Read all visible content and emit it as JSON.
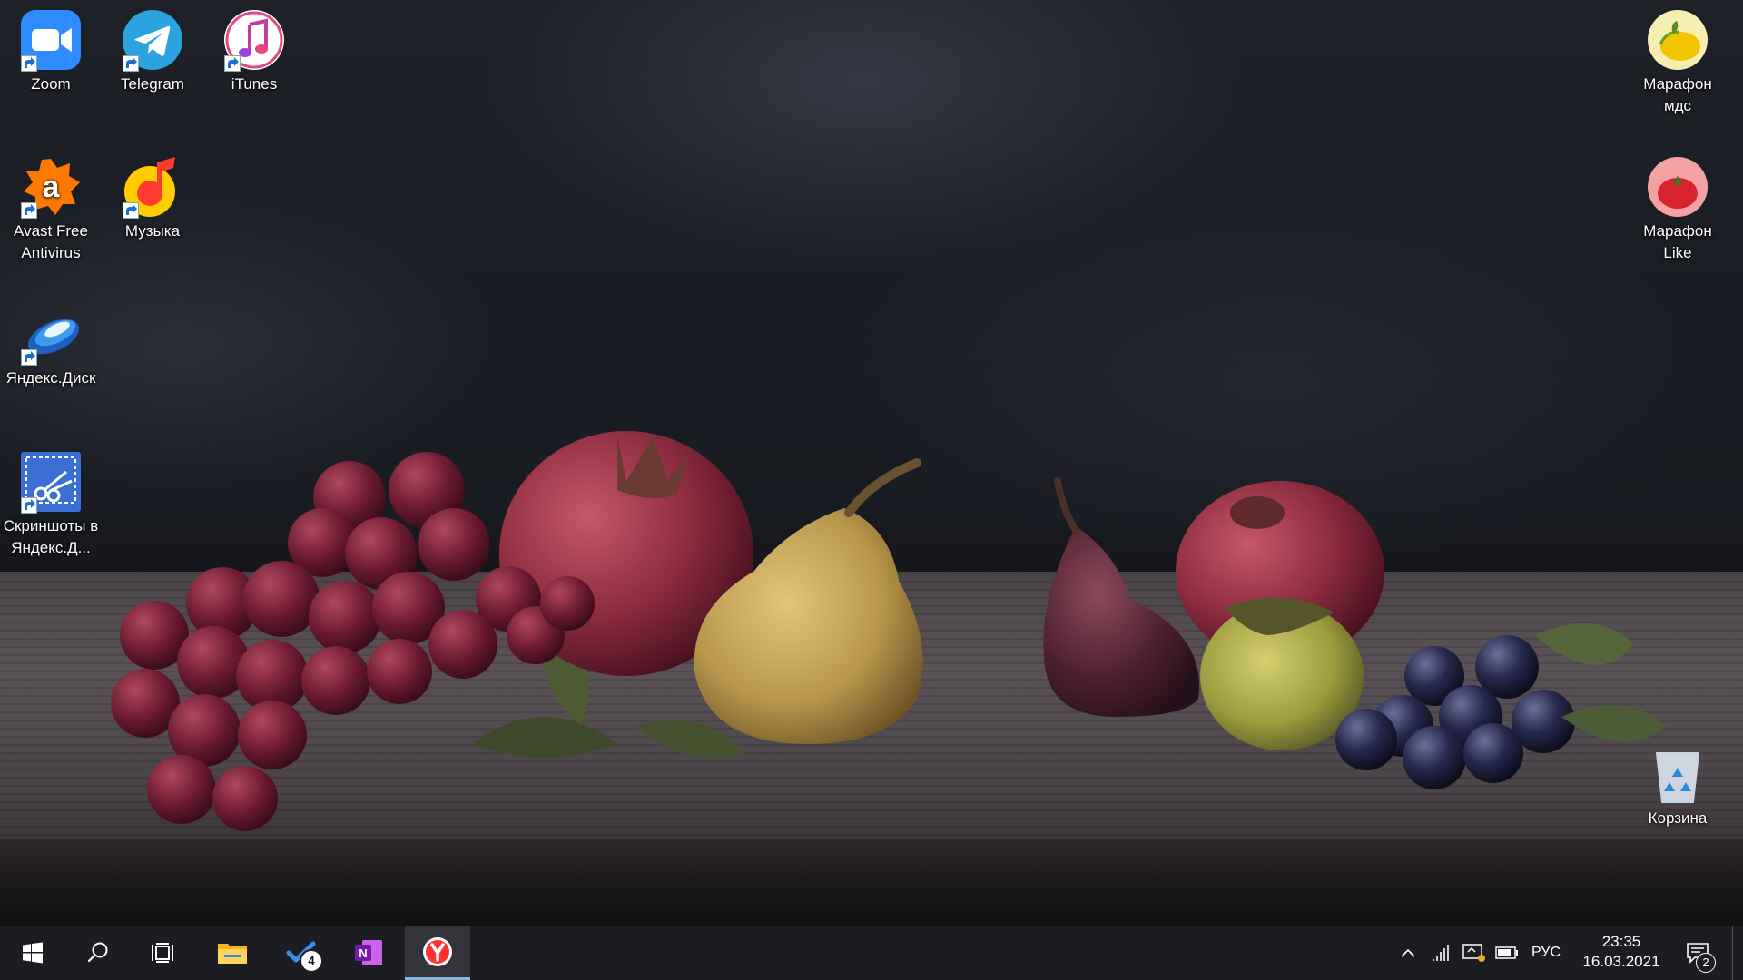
{
  "desktop": {
    "icons_left": [
      {
        "id": "zoom",
        "label": "Zoom"
      },
      {
        "id": "telegram",
        "label": "Telegram"
      },
      {
        "id": "itunes",
        "label": "iTunes"
      },
      {
        "id": "avast",
        "label": "Avast Free Antivirus"
      },
      {
        "id": "music",
        "label": "Музыка"
      },
      {
        "id": "yadisk",
        "label": "Яндекс.Диск"
      },
      {
        "id": "screenshots",
        "label": "Скриншоты в Яндекс.Д..."
      }
    ],
    "icons_right": [
      {
        "id": "marathon-mds",
        "label": "Марафон мдс"
      },
      {
        "id": "marathon-like",
        "label": "Марафон Like"
      },
      {
        "id": "recycle-bin",
        "label": "Корзина"
      }
    ]
  },
  "taskbar": {
    "pinned": [
      {
        "id": "start",
        "icon": "windows-logo-icon"
      },
      {
        "id": "search",
        "icon": "search-icon"
      },
      {
        "id": "task-view",
        "icon": "task-view-icon"
      },
      {
        "id": "file-explorer",
        "icon": "folder-icon"
      },
      {
        "id": "todo",
        "icon": "checkmark-icon",
        "badge": "4"
      },
      {
        "id": "onenote",
        "icon": "onenote-icon"
      },
      {
        "id": "yandex-browser",
        "icon": "yandex-browser-icon",
        "active": true
      }
    ],
    "tray": {
      "language": "РУС",
      "time": "23:35",
      "date": "16.03.2021",
      "notifications_count": "2"
    }
  },
  "colors": {
    "taskbar_bg": "#1c1d22",
    "active_indicator": "#8fb4d9"
  }
}
